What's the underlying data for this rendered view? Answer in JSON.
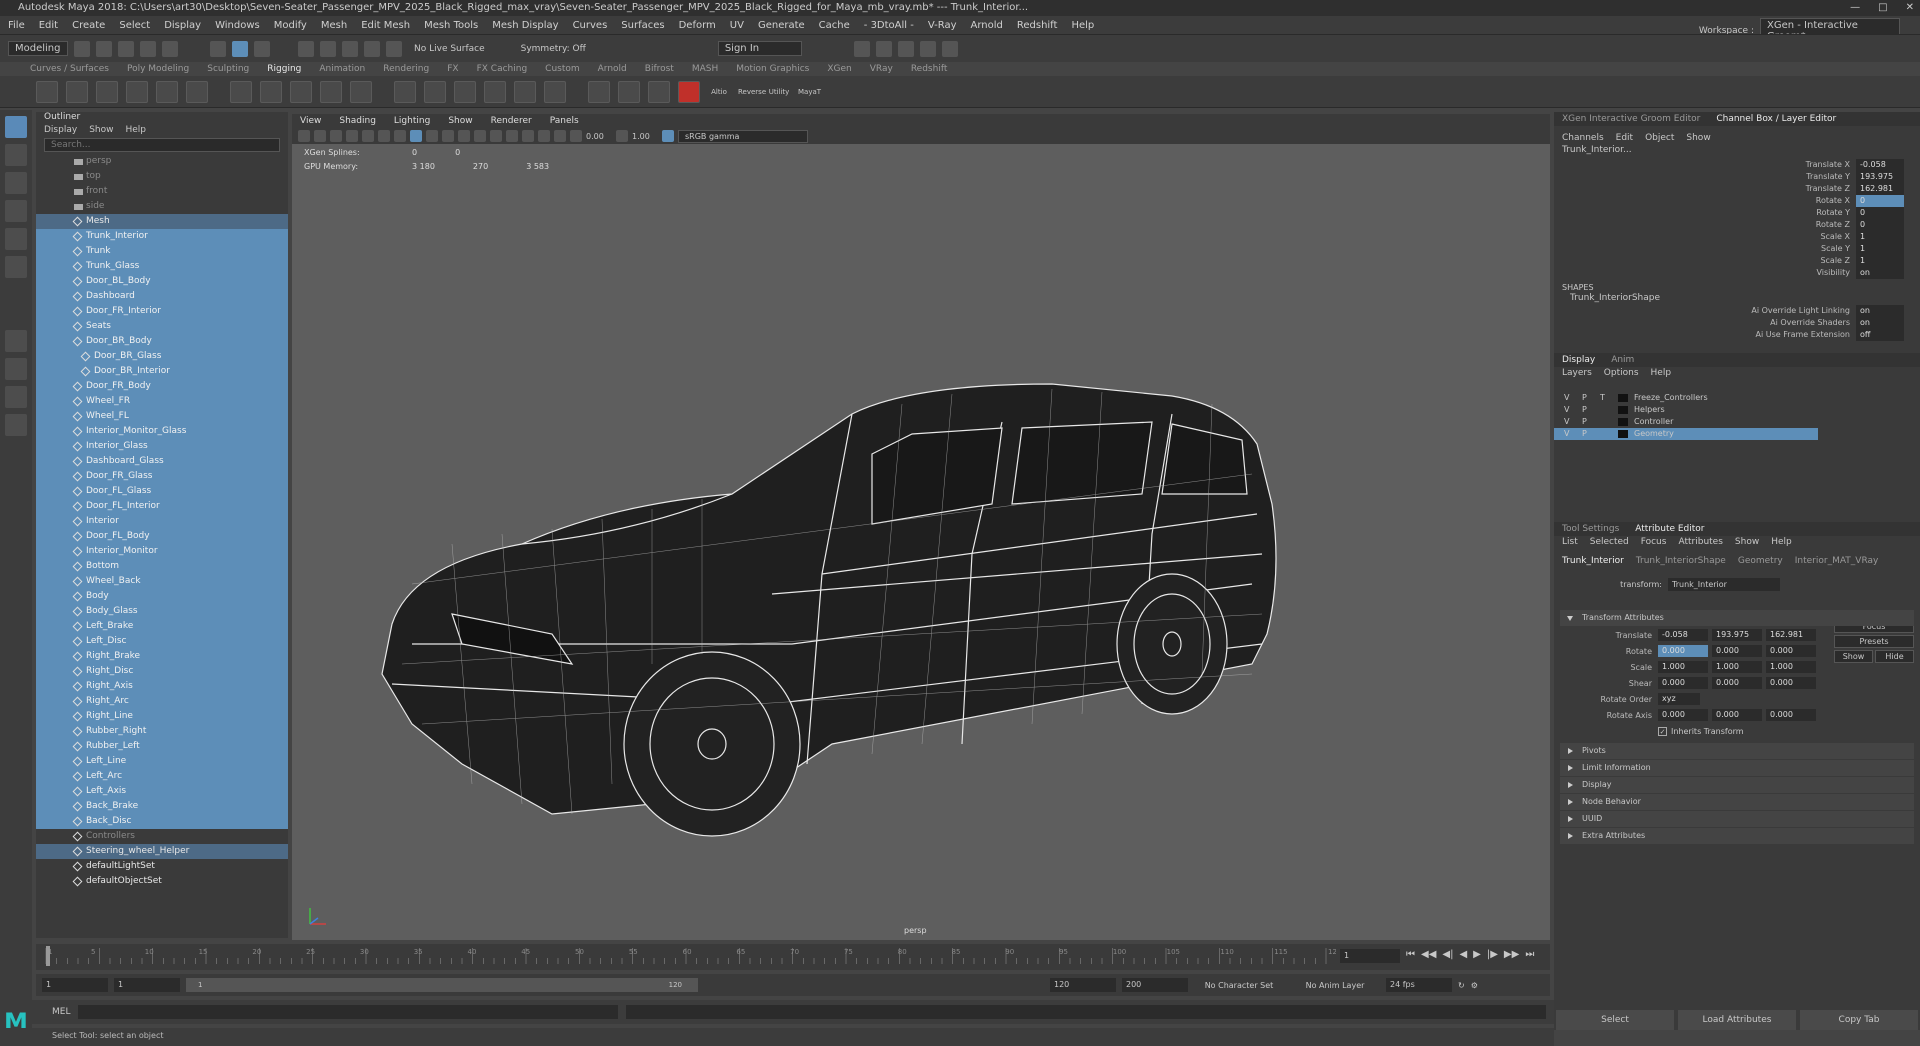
{
  "window": {
    "title": "Autodesk Maya 2018: C:\\Users\\art30\\Desktop\\Seven-Seater_Passenger_MPV_2025_Black_Rigged_max_vray\\Seven-Seater_Passenger_MPV_2025_Black_Rigged_for_Maya_mb_vray.mb* --- Trunk_Interior..."
  },
  "menubar": [
    "File",
    "Edit",
    "Create",
    "Select",
    "Display",
    "Windows",
    "Modify",
    "Mesh",
    "Edit Mesh",
    "Mesh Tools",
    "Mesh Display",
    "Curves",
    "Surfaces",
    "Deform",
    "UV",
    "Generate",
    "Cache",
    "- 3DtoAll -",
    "V-Ray",
    "Arnold",
    "Redshift",
    "Help"
  ],
  "workspace": {
    "label": "Workspace :",
    "value": "XGen - Interactive Groom*"
  },
  "statusline": {
    "mode": "Modeling",
    "live_surface": "No Live Surface",
    "symmetry": "Symmetry: Off",
    "sign_in": "Sign In"
  },
  "shelf_tabs": [
    "Curves / Surfaces",
    "Poly Modeling",
    "Sculpting",
    "Rigging",
    "Animation",
    "Rendering",
    "FX",
    "FX Caching",
    "Custom",
    "Arnold",
    "Bifrost",
    "MASH",
    "Motion Graphics",
    "XGen",
    "VRay",
    "Redshift"
  ],
  "shelf_active": "Rigging",
  "shelf_icon_labels": [
    "Altio",
    "Reverse",
    "Utility",
    "MayaT"
  ],
  "outliner": {
    "title": "Outliner",
    "menu": [
      "Display",
      "Show",
      "Help"
    ],
    "search_placeholder": "Search...",
    "items": [
      {
        "label": "persp",
        "kind": "cam",
        "dim": true
      },
      {
        "label": "top",
        "kind": "cam",
        "dim": true
      },
      {
        "label": "front",
        "kind": "cam",
        "dim": true
      },
      {
        "label": "side",
        "kind": "cam",
        "dim": true
      },
      {
        "label": "Mesh",
        "kind": "grp",
        "sel": "hdr"
      },
      {
        "label": "Trunk_Interior",
        "sel": true
      },
      {
        "label": "Trunk",
        "sel": true
      },
      {
        "label": "Trunk_Glass",
        "sel": true
      },
      {
        "label": "Door_BL_Body",
        "sel": true
      },
      {
        "label": "Dashboard",
        "sel": true
      },
      {
        "label": "Door_FR_Interior",
        "sel": true
      },
      {
        "label": "Seats",
        "sel": true
      },
      {
        "label": "Door_BR_Body",
        "sel": true
      },
      {
        "label": "Door_BR_Glass",
        "sel": true,
        "indent": true
      },
      {
        "label": "Door_BR_Interior",
        "sel": true,
        "indent": true
      },
      {
        "label": "Door_FR_Body",
        "sel": true
      },
      {
        "label": "Wheel_FR",
        "sel": true
      },
      {
        "label": "Wheel_FL",
        "sel": true
      },
      {
        "label": "Interior_Monitor_Glass",
        "sel": true
      },
      {
        "label": "Interior_Glass",
        "sel": true
      },
      {
        "label": "Dashboard_Glass",
        "sel": true
      },
      {
        "label": "Door_FR_Glass",
        "sel": true
      },
      {
        "label": "Door_FL_Glass",
        "sel": true
      },
      {
        "label": "Door_FL_Interior",
        "sel": true
      },
      {
        "label": "Interior",
        "sel": true
      },
      {
        "label": "Door_FL_Body",
        "sel": true
      },
      {
        "label": "Interior_Monitor",
        "sel": true
      },
      {
        "label": "Bottom",
        "sel": true
      },
      {
        "label": "Wheel_Back",
        "sel": true
      },
      {
        "label": "Body",
        "sel": true
      },
      {
        "label": "Body_Glass",
        "sel": true
      },
      {
        "label": "Left_Brake",
        "sel": true
      },
      {
        "label": "Left_Disc",
        "sel": true
      },
      {
        "label": "Right_Brake",
        "sel": true
      },
      {
        "label": "Right_Disc",
        "sel": true
      },
      {
        "label": "Right_Axis",
        "sel": true
      },
      {
        "label": "Right_Arc",
        "sel": true
      },
      {
        "label": "Right_Line",
        "sel": true
      },
      {
        "label": "Rubber_Right",
        "sel": true
      },
      {
        "label": "Rubber_Left",
        "sel": true
      },
      {
        "label": "Left_Line",
        "sel": true
      },
      {
        "label": "Left_Arc",
        "sel": true
      },
      {
        "label": "Left_Axis",
        "sel": true
      },
      {
        "label": "Back_Brake",
        "sel": true
      },
      {
        "label": "Back_Disc",
        "sel": true
      },
      {
        "label": "Controllers",
        "dim": true
      },
      {
        "label": "Steering_wheel_Helper",
        "sel": "hdr"
      },
      {
        "label": "defaultLightSet"
      },
      {
        "label": "defaultObjectSet"
      }
    ]
  },
  "viewport": {
    "menu": [
      "View",
      "Shading",
      "Lighting",
      "Show",
      "Renderer",
      "Panels"
    ],
    "exposure": "0.00",
    "gamma": "1.00",
    "colorspace": "sRGB gamma",
    "hud": [
      {
        "label": "XGen Splines:",
        "a": "0",
        "b": "0",
        "c": ""
      },
      {
        "label": "GPU Memory:",
        "a": "3 180",
        "b": "270",
        "c": "3 583"
      }
    ],
    "camera_label": "persp"
  },
  "channelbox": {
    "tabs": [
      "XGen Interactive Groom Editor",
      "Channel Box / Layer Editor"
    ],
    "menu": [
      "Channels",
      "Edit",
      "Object",
      "Show"
    ],
    "object": "Trunk_Interior...",
    "channels": [
      {
        "label": "Translate X",
        "value": "-0.058"
      },
      {
        "label": "Translate Y",
        "value": "193.975"
      },
      {
        "label": "Translate Z",
        "value": "162.981"
      },
      {
        "label": "Rotate X",
        "value": "0",
        "hl": true
      },
      {
        "label": "Rotate Y",
        "value": "0"
      },
      {
        "label": "Rotate Z",
        "value": "0"
      },
      {
        "label": "Scale X",
        "value": "1"
      },
      {
        "label": "Scale Y",
        "value": "1"
      },
      {
        "label": "Scale Z",
        "value": "1"
      },
      {
        "label": "Visibility",
        "value": "on"
      }
    ],
    "shapes_label": "SHAPES",
    "shape_name": "Trunk_InteriorShape",
    "shape_channels": [
      {
        "label": "Ai Override Light Linking",
        "value": "on"
      },
      {
        "label": "Ai Override Shaders",
        "value": "on"
      },
      {
        "label": "Ai Use Frame Extension",
        "value": "off"
      }
    ]
  },
  "layers": {
    "tabs": [
      "Display",
      "Anim"
    ],
    "menu": [
      "Layers",
      "Options",
      "Help"
    ],
    "items": [
      {
        "v": "V",
        "p": "P",
        "t": "T",
        "name": "Freeze_Controllers"
      },
      {
        "v": "V",
        "p": "P",
        "t": "",
        "name": "Helpers"
      },
      {
        "v": "V",
        "p": "P",
        "t": "",
        "name": "Controller"
      },
      {
        "v": "V",
        "p": "P",
        "t": "",
        "name": "Geometry",
        "sel": true
      }
    ]
  },
  "attribute_editor": {
    "tabs": [
      "Tool Settings",
      "Attribute Editor"
    ],
    "menu": [
      "List",
      "Selected",
      "Focus",
      "Attributes",
      "Show",
      "Help"
    ],
    "node_tabs": [
      "Trunk_Interior",
      "Trunk_InteriorShape",
      "Geometry",
      "Interior_MAT_VRay"
    ],
    "transform_label": "transform:",
    "transform_value": "Trunk_Interior",
    "side_buttons": [
      "Focus",
      "Presets",
      "Show",
      "Hide"
    ],
    "section_open": "Transform Attributes",
    "rows": [
      {
        "label": "Translate",
        "v": [
          "-0.058",
          "193.975",
          "162.981"
        ]
      },
      {
        "label": "Rotate",
        "v": [
          "0.000",
          "0.000",
          "0.000"
        ],
        "hl": 0
      },
      {
        "label": "Scale",
        "v": [
          "1.000",
          "1.000",
          "1.000"
        ]
      },
      {
        "label": "Shear",
        "v": [
          "0.000",
          "0.000",
          "0.000"
        ]
      }
    ],
    "rotate_order_label": "Rotate Order",
    "rotate_order": "xyz",
    "rotate_axis": {
      "label": "Rotate Axis",
      "v": [
        "0.000",
        "0.000",
        "0.000"
      ]
    },
    "inherits": "Inherits Transform",
    "sections": [
      "Pivots",
      "Limit Information",
      "Display",
      "Node Behavior",
      "UUID",
      "Extra Attributes"
    ],
    "bottom_buttons": [
      "Select",
      "Load Attributes",
      "Copy Tab"
    ]
  },
  "timeline": {
    "ticks": [
      "1",
      "5",
      "10",
      "15",
      "20",
      "25",
      "30",
      "35",
      "40",
      "45",
      "50",
      "55",
      "60",
      "65",
      "70",
      "75",
      "80",
      "85",
      "90",
      "95",
      "100",
      "105",
      "110",
      "115",
      "120"
    ],
    "current_frame": "1"
  },
  "range": {
    "start": "1",
    "start2": "1",
    "slider_start": "1",
    "slider_end": "120",
    "end": "120",
    "max": "200",
    "character": "No Character Set",
    "anim_layer": "No Anim Layer",
    "fps": "24 fps"
  },
  "cmdline": {
    "label": "MEL"
  },
  "helpline": {
    "text": "Select Tool: select an object"
  },
  "colors": {
    "selection": "#5d8eb8",
    "background": "#444444",
    "maya_logo": "#27c2c0"
  }
}
